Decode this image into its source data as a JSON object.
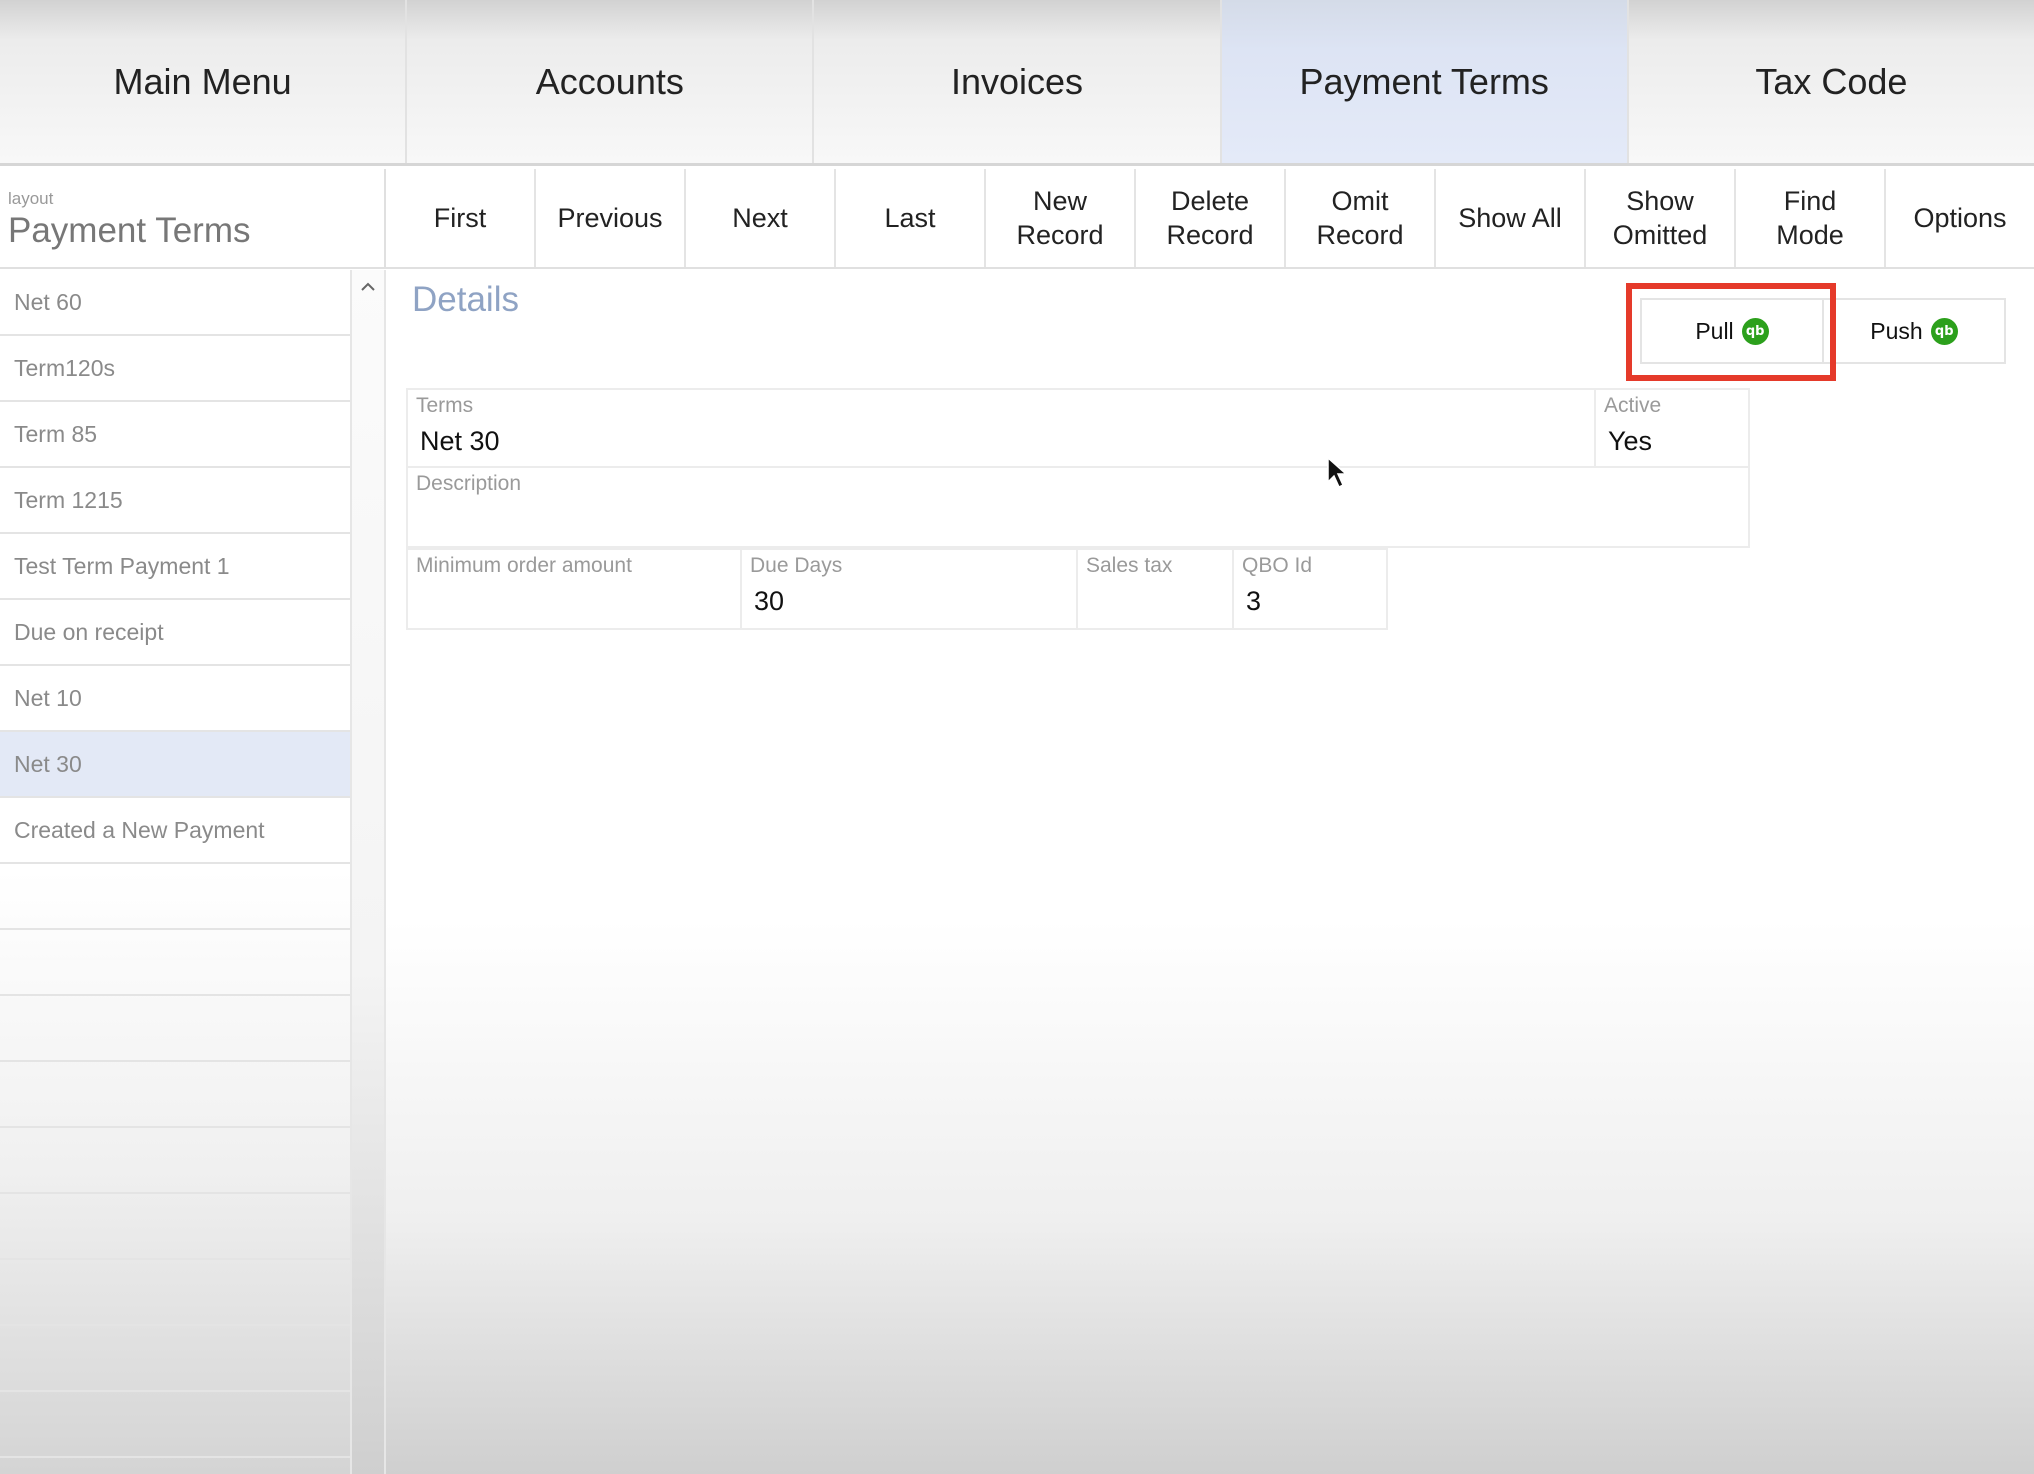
{
  "nav": {
    "tabs": [
      {
        "label": "Main Menu"
      },
      {
        "label": "Accounts"
      },
      {
        "label": "Invoices"
      },
      {
        "label": "Payment Terms"
      },
      {
        "label": "Tax Code"
      }
    ],
    "active_index": 3
  },
  "layout": {
    "caption": "layout",
    "name": "Payment Terms"
  },
  "toolbar": {
    "first": "First",
    "previous": "Previous",
    "next": "Next",
    "last": "Last",
    "new_record": "New\nRecord",
    "delete_record": "Delete\nRecord",
    "omit_record": "Omit\nRecord",
    "show_all": "Show All",
    "show_omitted": "Show\nOmitted",
    "find_mode": "Find\nMode",
    "options": "Options"
  },
  "list": {
    "items": [
      "Net 60",
      "Term120s",
      "Term 85",
      "Term 1215",
      "Test Term Payment 1",
      "Due on receipt",
      "Net 10",
      "Net 30",
      "Created a New Payment"
    ],
    "selected_index": 7
  },
  "details": {
    "title": "Details",
    "pull_label": "Pull",
    "push_label": "Push",
    "qb_logo": "qb",
    "fields": {
      "terms": {
        "label": "Terms",
        "value": "Net 30"
      },
      "active": {
        "label": "Active",
        "value": "Yes"
      },
      "description": {
        "label": "Description",
        "value": ""
      },
      "minimum_order_amount": {
        "label": "Minimum order amount",
        "value": ""
      },
      "due_days": {
        "label": "Due Days",
        "value": "30"
      },
      "sales_tax": {
        "label": "Sales tax",
        "value": ""
      },
      "qbo_id": {
        "label": "QBO Id",
        "value": "3"
      }
    }
  },
  "colors": {
    "active_tab": "#dde4f4",
    "selected_row": "#e3e9f6",
    "details_title": "#8fa3c4",
    "highlight": "#e53a2a",
    "qb_green": "#2ca01c"
  }
}
